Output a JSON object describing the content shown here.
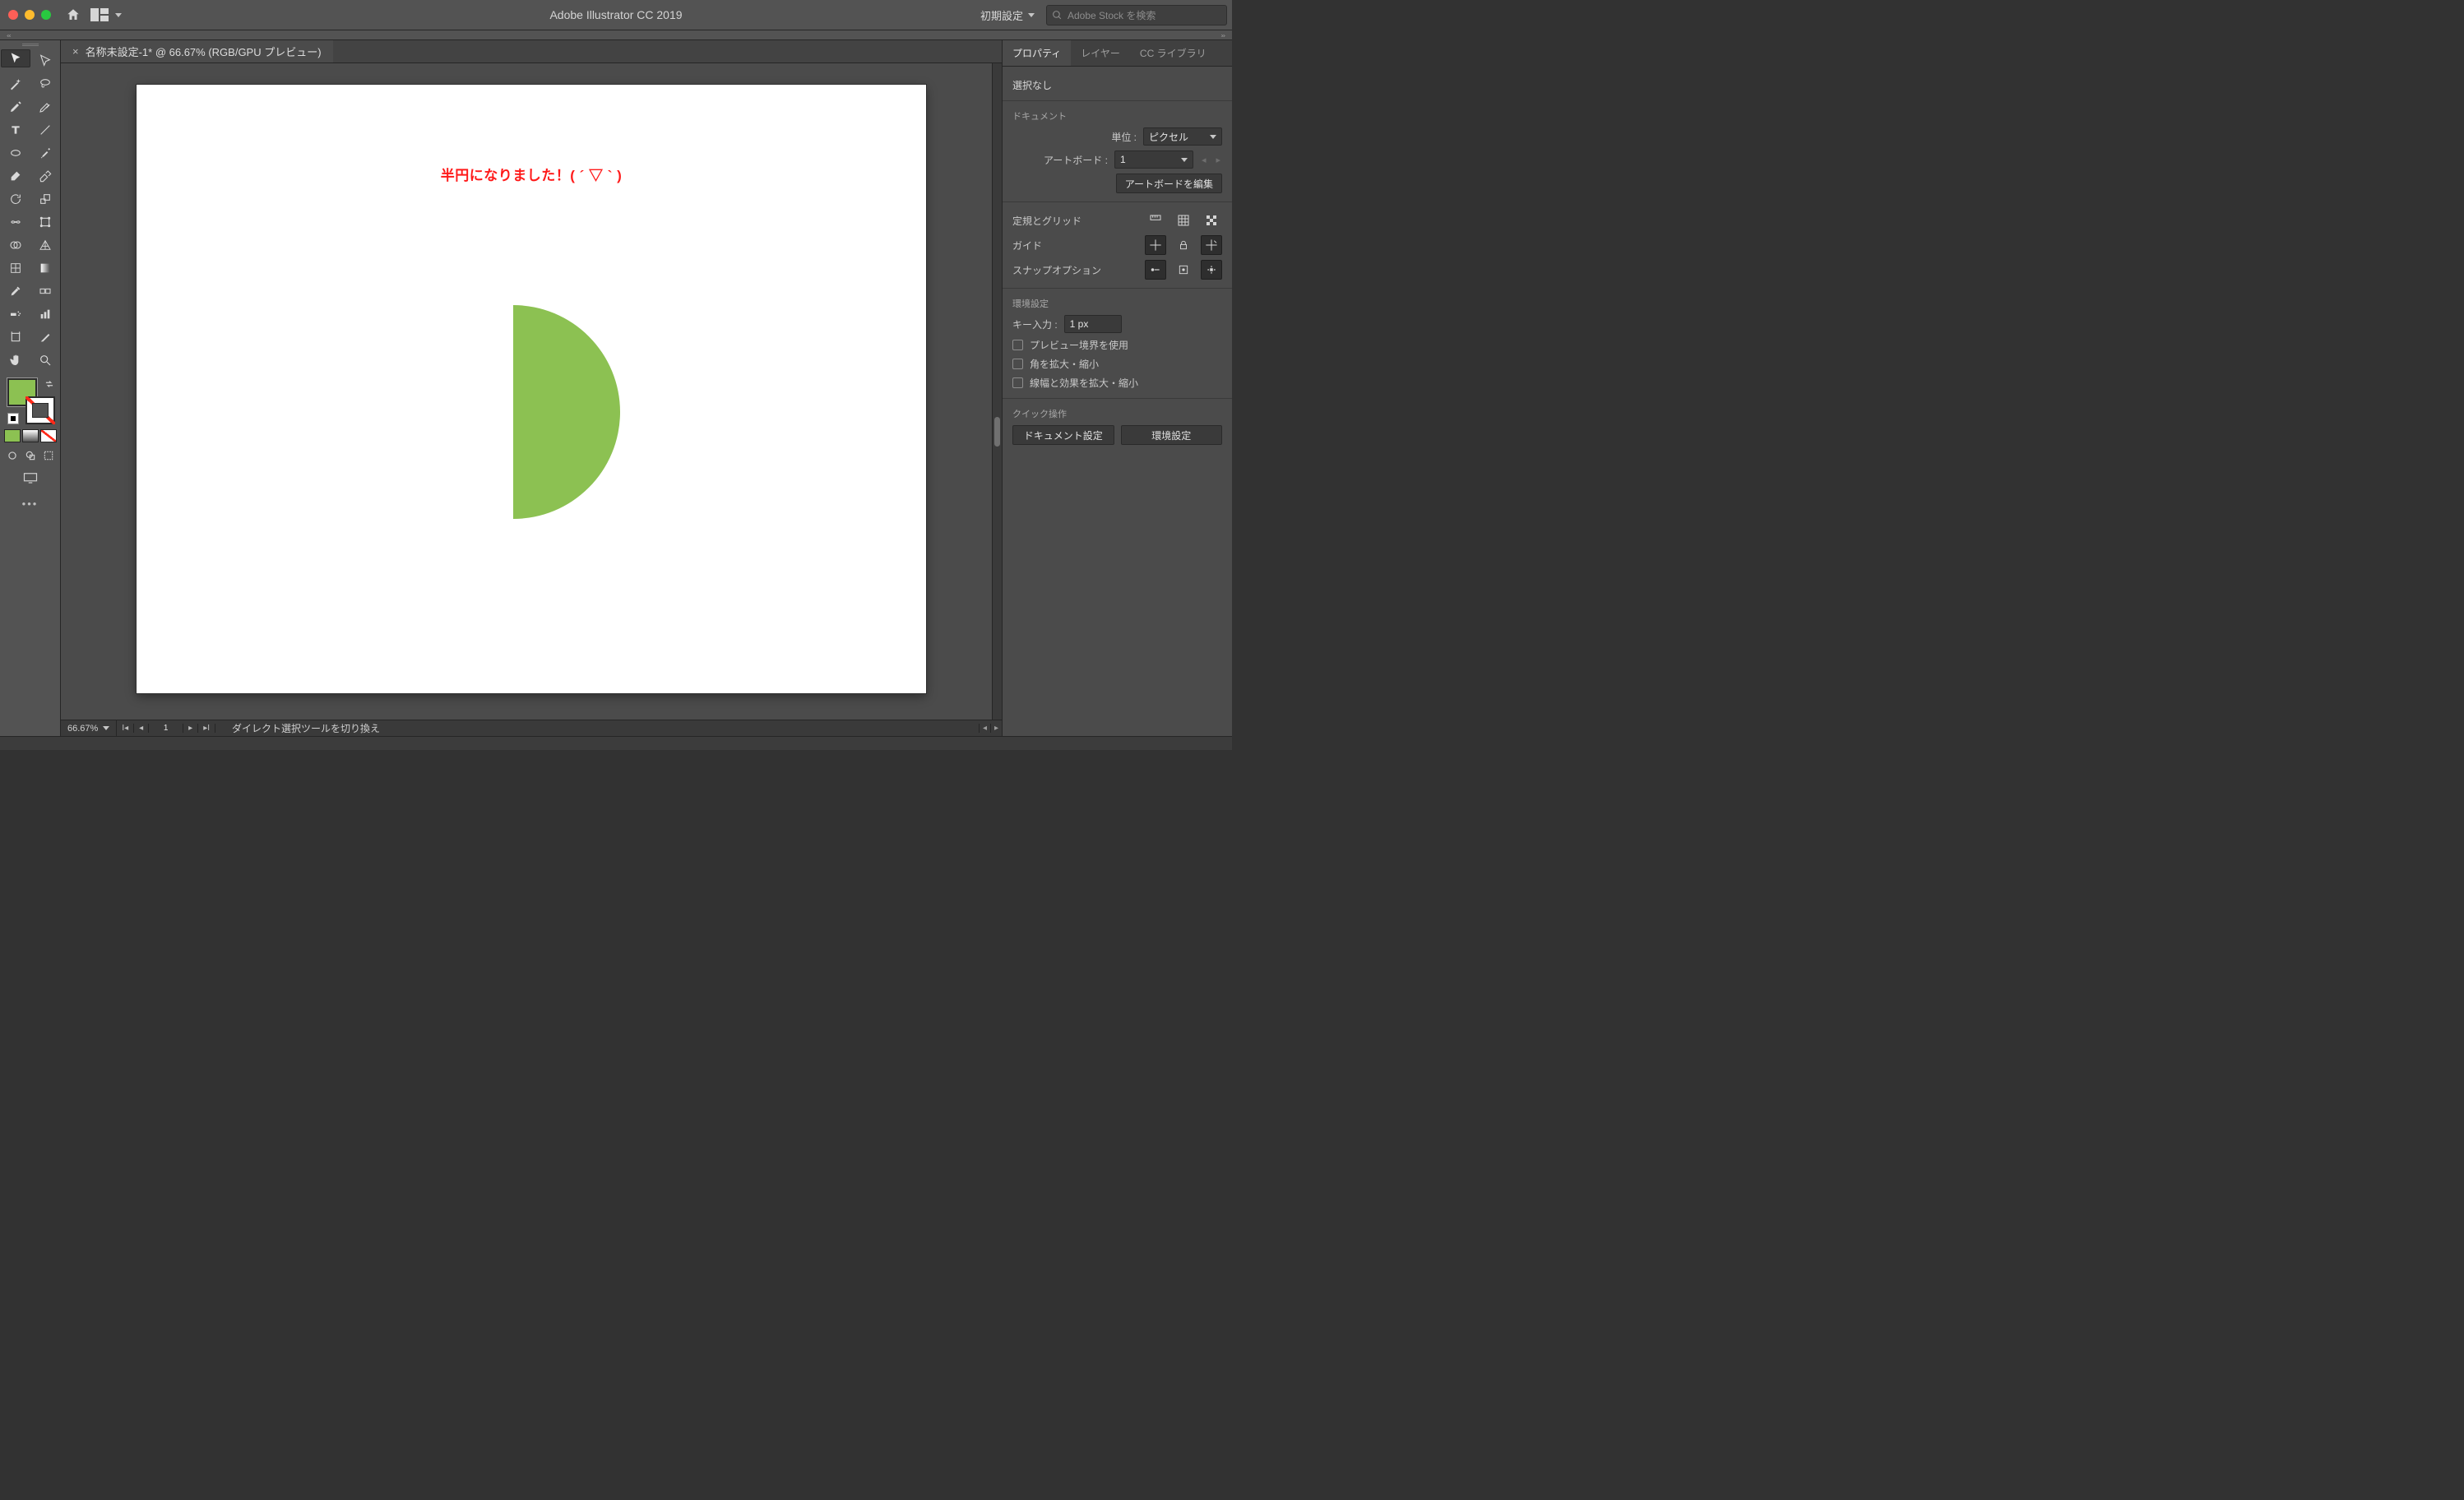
{
  "titlebar": {
    "app_title": "Adobe Illustrator CC 2019",
    "workspace": "初期設定",
    "search_placeholder": "Adobe Stock を検索"
  },
  "doc_tab": {
    "close": "×",
    "label": "名称未設定-1* @ 66.67% (RGB/GPU プレビュー)"
  },
  "canvas": {
    "caption": "半円になりました！( ´ ▽ ` )",
    "shape_fill": "#8cc152"
  },
  "docfooter": {
    "zoom": "66.67%",
    "artboard_num": "1",
    "status": "ダイレクト選択ツールを切り換え"
  },
  "panel": {
    "tabs": {
      "properties": "プロパティ",
      "layers": "レイヤー",
      "cc_lib": "CC ライブラリ"
    },
    "selection_none": "選択なし",
    "document_label": "ドキュメント",
    "unit_label": "単位 :",
    "unit_value": "ピクセル",
    "artboard_label": "アートボード :",
    "artboard_value": "1",
    "edit_artboards": "アートボードを編集",
    "rulers_grid_label": "定規とグリッド",
    "guides_label": "ガイド",
    "snap_label": "スナップオプション",
    "prefs_label": "環境設定",
    "key_label": "キー入力 :",
    "key_value": "1 px",
    "cb_preview": "プレビュー境界を使用",
    "cb_scale_corners": "角を拡大・縮小",
    "cb_scale_strokes": "線幅と効果を拡大・縮小",
    "quick_label": "クイック操作",
    "btn_doc_setup": "ドキュメント設定",
    "btn_prefs": "環境設定"
  }
}
